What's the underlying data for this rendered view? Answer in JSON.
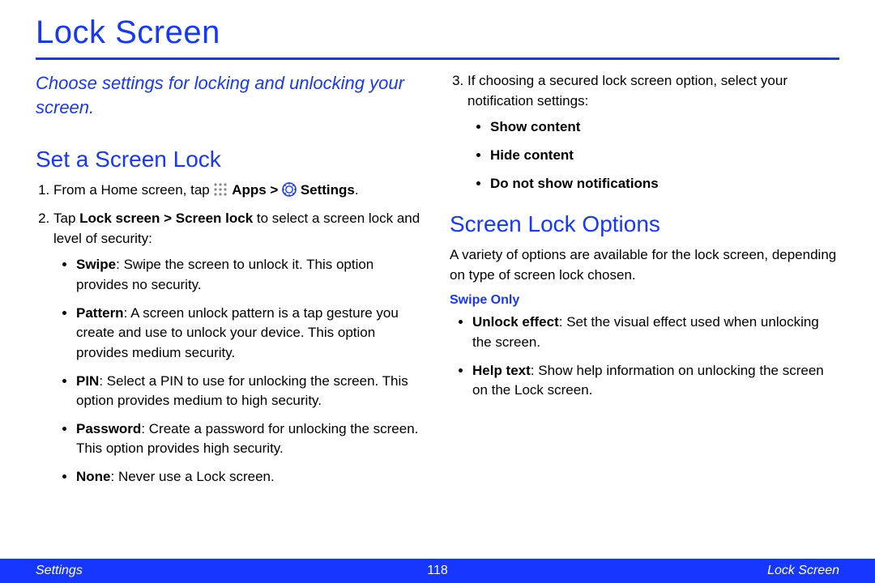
{
  "title": "Lock Screen",
  "intro": "Choose settings for locking and unlocking your screen.",
  "h2_set": "Set a Screen Lock",
  "step1_a": "From a Home screen, tap ",
  "step1_apps": "Apps > ",
  "step1_settings": "Settings",
  "step1_period": ".",
  "step2_a": "Tap ",
  "step2_b": "Lock screen > Screen lock",
  "step2_c": " to select a screen lock and level of security:",
  "opt_swipe_t": "Swipe",
  "opt_swipe_d": ": Swipe the screen to unlock it. This option provides no security.",
  "opt_pattern_t": "Pattern",
  "opt_pattern_d": ": A screen unlock pattern is a tap gesture you create and use to unlock your device. This option provides medium security.",
  "opt_pin_t": "PIN",
  "opt_pin_d": ": Select a PIN to use for unlocking the screen. This option provides medium to high security.",
  "opt_pwd_t": "Password",
  "opt_pwd_d": ": Create a password for unlocking the screen. This option provides high security.",
  "opt_none_t": "None",
  "opt_none_d": ": Never use a Lock screen.",
  "step3": "If choosing a secured lock screen option, select your notification settings:",
  "notif1": "Show content",
  "notif2": "Hide content",
  "notif3": "Do not show notifications",
  "h2_opts": "Screen Lock Options",
  "opts_para": "A variety of options are available for the lock screen, depending on type of screen lock chosen.",
  "swipe_only": "Swipe Only",
  "unlock_eff_t": "Unlock effect",
  "unlock_eff_d": ": Set the visual effect used when unlocking the screen.",
  "help_t": "Help text",
  "help_d": ": Show help information on unlocking the screen on the Lock screen.",
  "footer_left": "Settings",
  "footer_center": "118",
  "footer_right": "Lock Screen"
}
